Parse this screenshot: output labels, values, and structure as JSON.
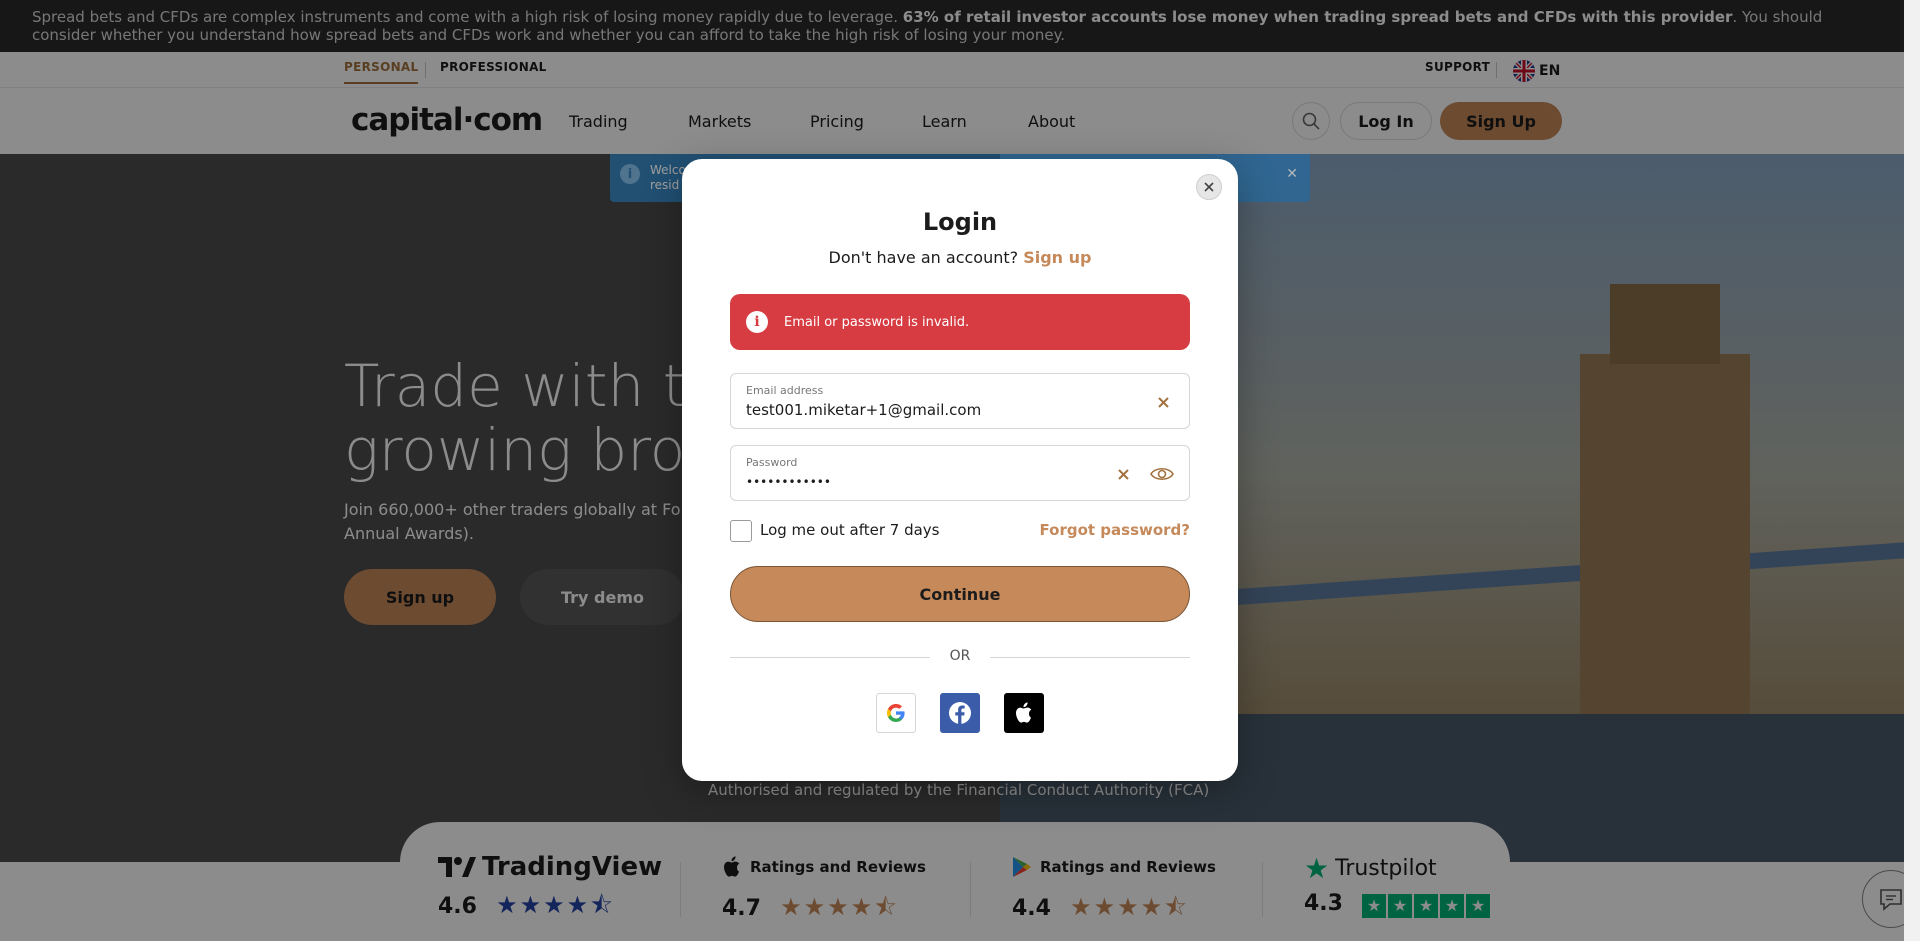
{
  "risk_banner": {
    "text_pre": "Spread bets and CFDs are complex instruments and come with a high risk of losing money rapidly due to leverage. ",
    "text_bold": "63% of retail investor accounts lose money when trading spread bets and CFDs with this provider",
    "text_post": ". You should consider whether you understand how spread bets and CFDs work and whether you can afford to take the high risk of losing your money."
  },
  "top_strip": {
    "personal": "PERSONAL",
    "professional": "PROFESSIONAL",
    "support": "SUPPORT",
    "language": "EN"
  },
  "header": {
    "logo": "capital·com",
    "nav": [
      "Trading",
      "Markets",
      "Pricing",
      "Learn",
      "About"
    ],
    "login": "Log In",
    "signup": "Sign Up"
  },
  "welcome_banner": {
    "text_line1": "Welco",
    "text_line2": "resid"
  },
  "hero": {
    "title_line1": "Trade with th",
    "title_line2": "growing broke",
    "subtitle": "Join 660,000+ other traders globally at ForexB Annual Awards).",
    "signup_button": "Sign up",
    "demo_button": "Try demo",
    "fca": "Authorised and regulated by the Financial Conduct Authority (FCA)"
  },
  "modal": {
    "title": "Login",
    "subtitle": "Don't have an account?",
    "signup_link": "Sign up",
    "error": "Email or password is invalid.",
    "email_label": "Email address",
    "email_value": "test001.miketar+1@gmail.com",
    "password_label": "Password",
    "password_value": "••••••••••••",
    "checkbox_label": "Log me out after 7 days",
    "checkbox_checked": false,
    "forgot": "Forgot password?",
    "continue": "Continue",
    "or": "OR",
    "social": [
      "google-icon",
      "facebook-icon",
      "apple-icon"
    ]
  },
  "ratings": [
    {
      "brand": "TradingView",
      "score": "4.6",
      "stars": 4.5
    },
    {
      "brand": "Ratings and Reviews",
      "score": "4.7",
      "stars": 4.5
    },
    {
      "brand": "Ratings and Reviews",
      "score": "4.4",
      "stars": 4.5
    },
    {
      "brand": "Trustpilot",
      "score": "4.3",
      "stars": 4.5
    }
  ],
  "colors": {
    "accent": "#c5895a",
    "error": "#d63c42",
    "facebook": "#3b5ca8",
    "trustpilot": "#00b67a",
    "tradingview_stars": "#2544a8"
  }
}
